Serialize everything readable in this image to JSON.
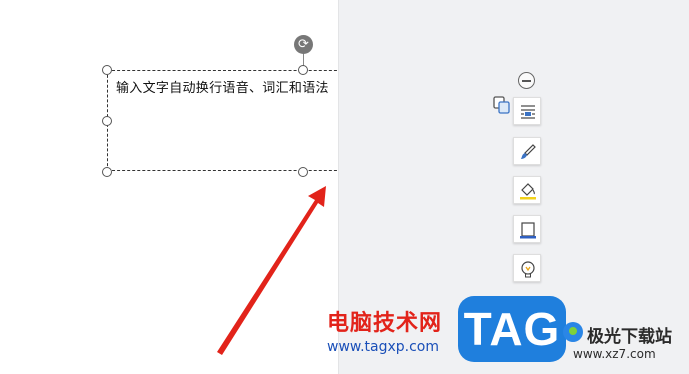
{
  "document": {
    "textbox_text": "输入文字自动换行语音、词汇和语法"
  },
  "toolbar": {
    "items": [
      {
        "name": "text-wrap",
        "icon": "text-wrap-icon"
      },
      {
        "name": "line-style",
        "icon": "brush-icon"
      },
      {
        "name": "fill",
        "icon": "fill-bucket-icon"
      },
      {
        "name": "border",
        "icon": "border-frame-icon"
      },
      {
        "name": "smart-tip",
        "icon": "lightbulb-icon"
      }
    ],
    "collapse_icon": "minus-circle-icon",
    "copy_icon": "copy-layout-icon"
  },
  "annotation": {
    "arrow_color": "#e2231a"
  },
  "watermark": {
    "site_title": "电脑技术网",
    "site_url": "www.tagxp.com",
    "tag_logo": "TAG",
    "brand_name": "极光下载站",
    "brand_url": "www.xz7.com"
  },
  "colors": {
    "canvas": "#f0f1f3",
    "tag_blue": "#1f7fdd",
    "title_red": "#e2231a",
    "url_blue": "#1a4fb8"
  }
}
